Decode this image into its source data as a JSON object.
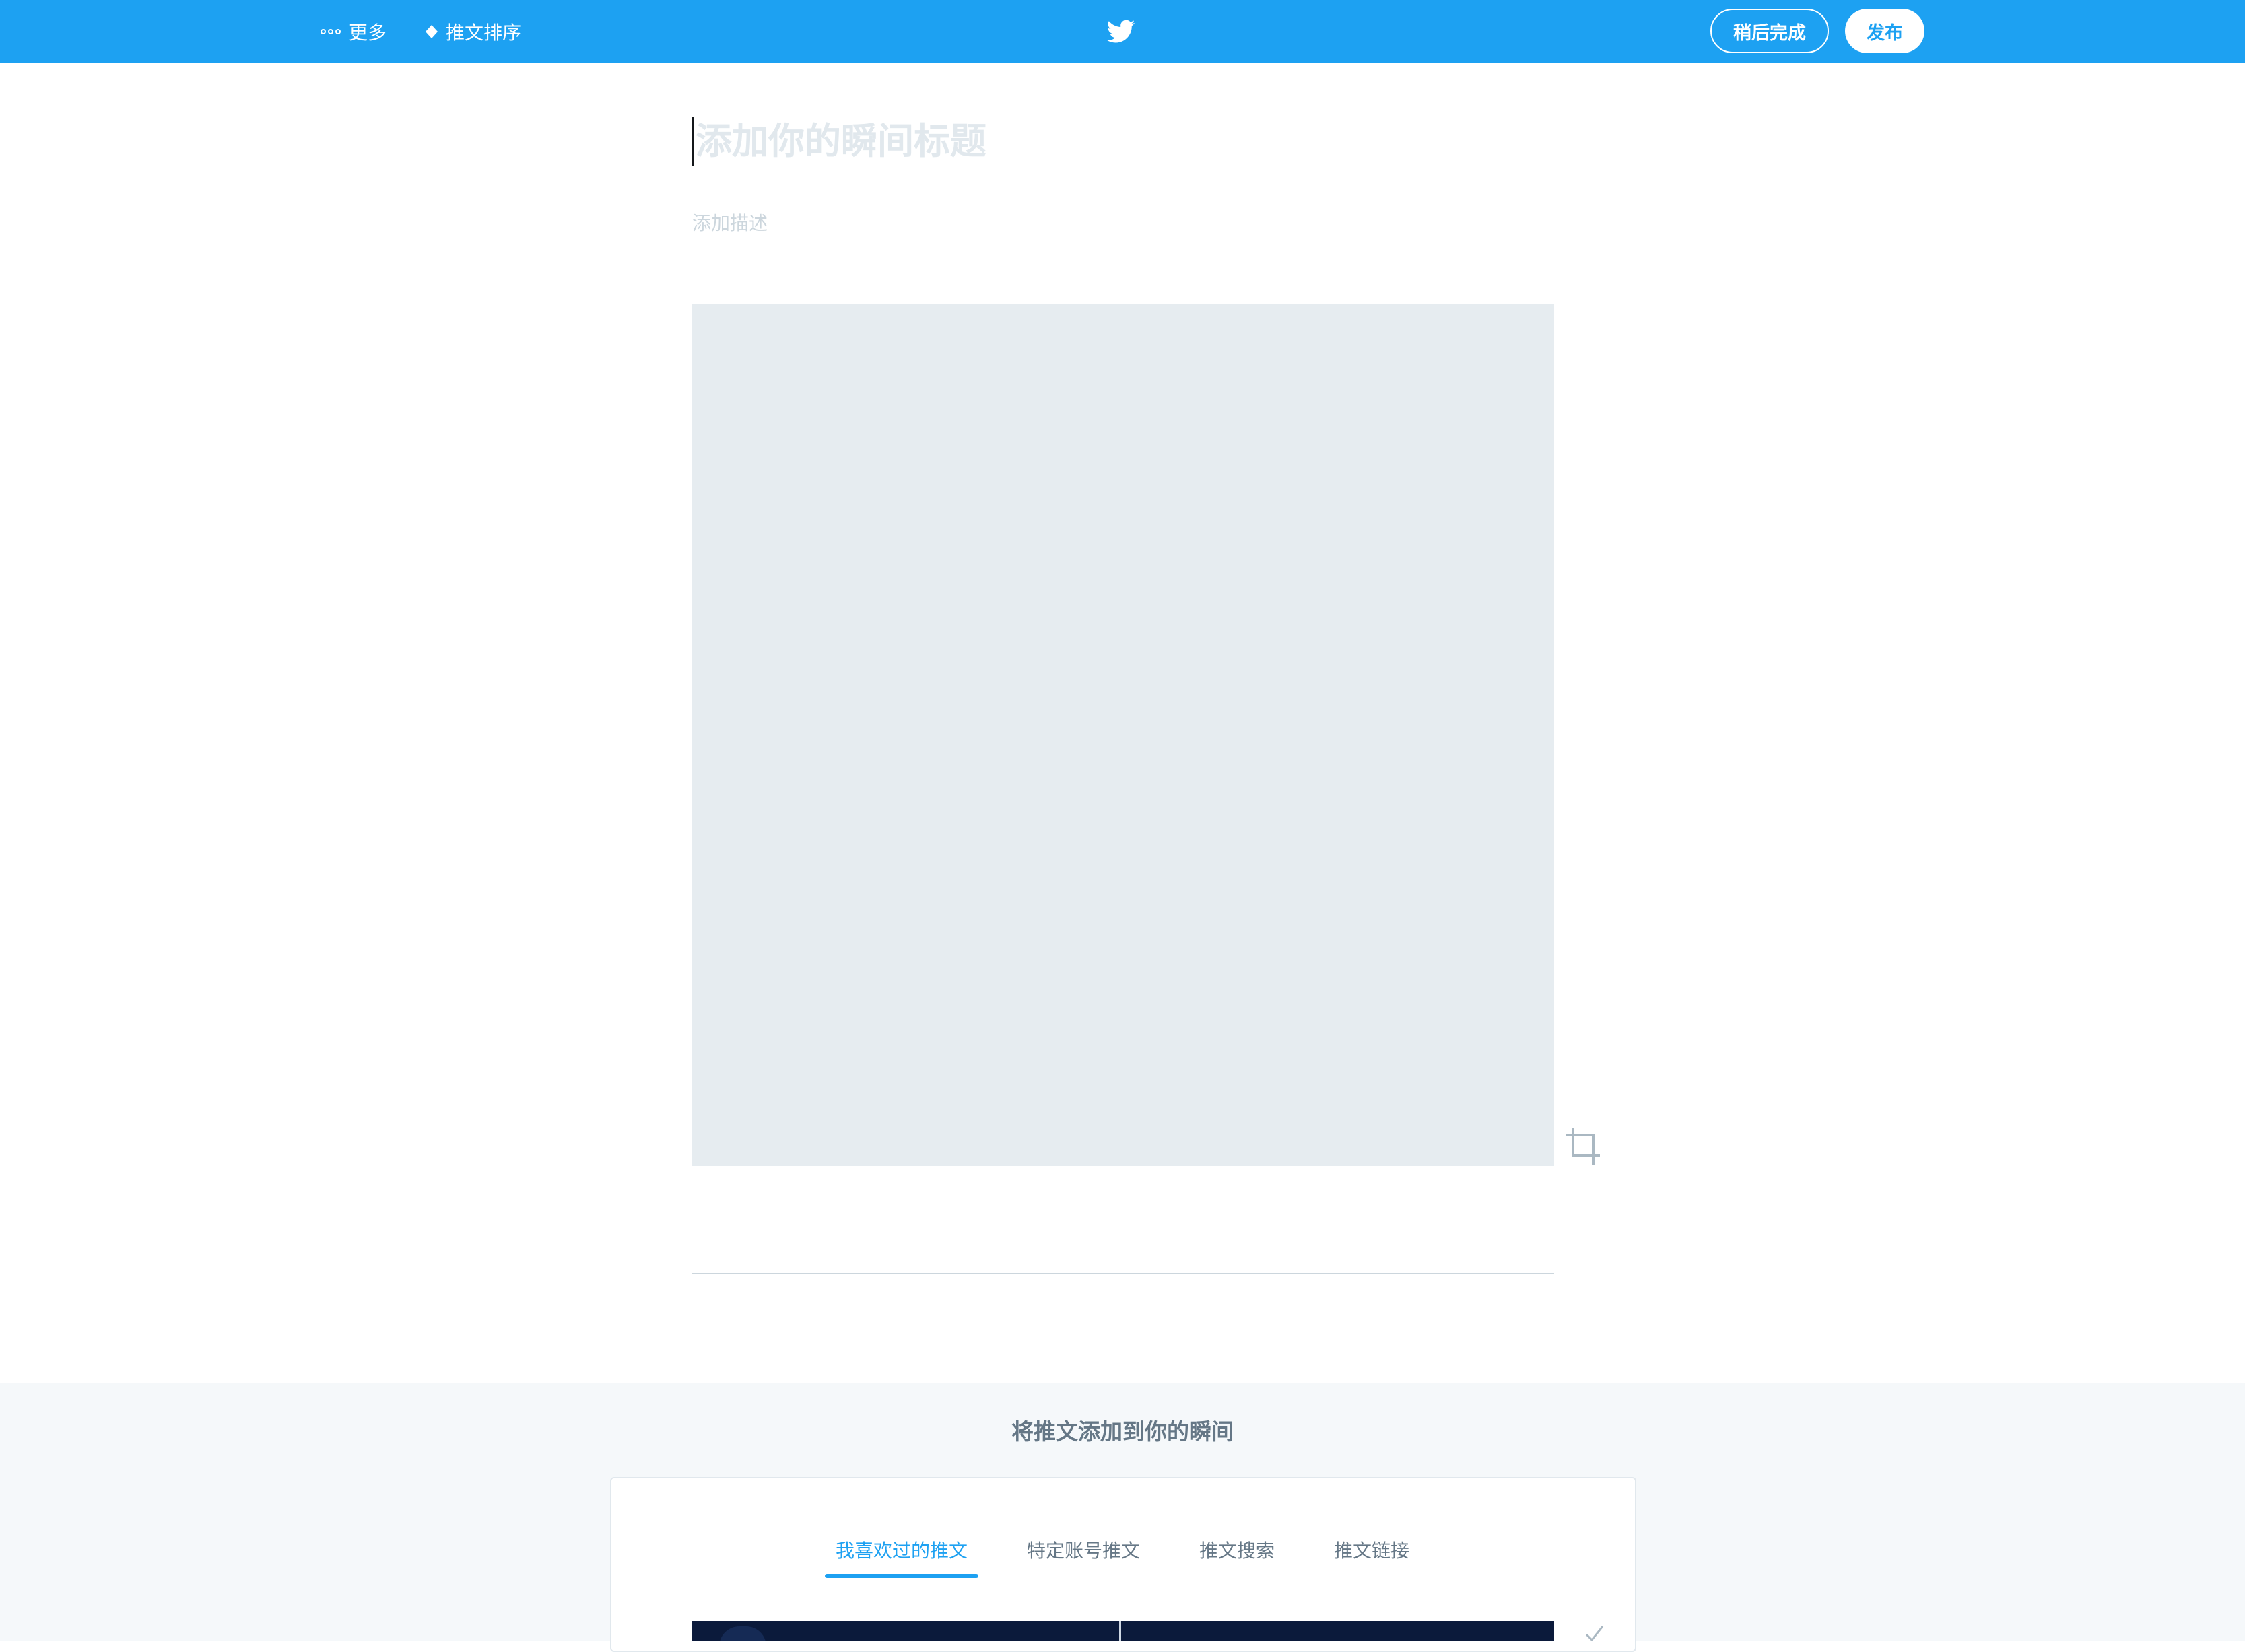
{
  "topbar": {
    "more_label": "更多",
    "sort_label": "推文排序",
    "finish_later_label": "稍后完成",
    "publish_label": "发布",
    "bg_color": "#1da1f2",
    "icons": {
      "more": "more-dots-icon",
      "sort": "sort-arrows-icon",
      "logo": "twitter-bird-icon"
    }
  },
  "editor": {
    "title_placeholder": "添加你的瞬间标题",
    "description_placeholder": "添加描述",
    "crop_icon": "crop-icon"
  },
  "add_tweets": {
    "heading": "将推文添加到你的瞬间",
    "tabs": [
      {
        "label": "我喜欢过的推文",
        "active": true
      },
      {
        "label": "特定账号推文",
        "active": false
      },
      {
        "label": "推文搜索",
        "active": false
      },
      {
        "label": "推文链接",
        "active": false
      }
    ],
    "accent_color": "#1da1f2",
    "select_icon": "checkmark-icon"
  }
}
